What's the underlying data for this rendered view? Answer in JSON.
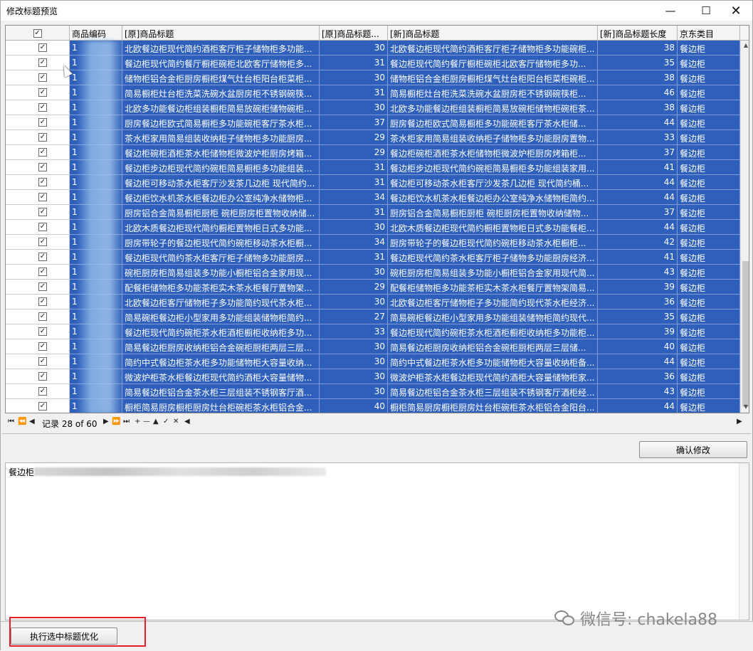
{
  "window": {
    "title": "修改标题预览",
    "min_icon": "minimize-icon",
    "max_icon": "maximize-icon",
    "close_icon": "close-icon"
  },
  "columns": [
    "",
    "商品编码",
    "[原]商品标题",
    "[原]商品标题...",
    "[新]商品标题",
    "[新]商品标题长度",
    "京东类目"
  ],
  "header_checkbox_checked": true,
  "rows": [
    {
      "code": "1",
      "orig": "北欧餐边柜现代简约酒柜客厅柜子储物柜多功能...",
      "orig_len": "30",
      "new": "北欧餐边柜现代简约酒柜客厅柜子储物柜多功能碗柜...",
      "new_len": "38",
      "cat": "餐边柜"
    },
    {
      "code": "1",
      "orig": "餐边柜现代简约餐厅橱柜碗柜北欧客厅储物柜多...",
      "orig_len": "31",
      "new": "餐边柜现代简约餐厅橱柜碗柜北欧客厅储物柜多功...",
      "new_len": "35",
      "cat": "餐边柜"
    },
    {
      "code": "1",
      "orig": "储物柜铝合金柜厨房橱柜煤气灶台柜阳台柜菜柜...",
      "orig_len": "30",
      "new": "储物柜铝合金柜厨房橱柜煤气灶台柜阳台柜菜柜碗柜...",
      "new_len": "38",
      "cat": "餐边柜"
    },
    {
      "code": "1",
      "orig": "简易橱柜灶台柜洗菜洗碗水盆厨房柜不锈钢碗筷...",
      "orig_len": "31",
      "new": "简易橱柜灶台柜洗菜洗碗水盆厨房柜不锈钢碗筷柜...",
      "new_len": "46",
      "cat": "餐边柜"
    },
    {
      "code": "1",
      "orig": "北欧多功能餐边柜组装橱柜简易放碗柜储物碗柜...",
      "orig_len": "30",
      "new": "北欧多功能餐边柜组装橱柜简易放碗柜储物柜碗柜茶...",
      "new_len": "38",
      "cat": "餐边柜"
    },
    {
      "code": "1",
      "orig": "厨房餐边柜欧式简易橱柜多功能碗柜客厅茶水柜...",
      "orig_len": "37",
      "new": "厨房餐边柜欧式简易橱柜多功能碗柜客厅茶水柜储...",
      "new_len": "44",
      "cat": "餐边柜"
    },
    {
      "code": "1",
      "orig": "茶水柜家用简易组装收纳柜子储物柜多功能厨房...",
      "orig_len": "29",
      "new": "茶水柜家用简易组装收纳柜子储物柜多功能厨房置物...",
      "new_len": "33",
      "cat": "餐边柜"
    },
    {
      "code": "1",
      "orig": "餐边柜碗柜酒柜茶水柜储物柜微波炉柜厨房烤箱...",
      "orig_len": "29",
      "new": "餐边柜碗柜酒柜茶水柜储物柜微波炉柜厨房烤箱柜...",
      "new_len": "37",
      "cat": "餐边柜"
    },
    {
      "code": "1",
      "orig": "餐边柜步边柜现代简约碗柜简易橱柜多功能组装...",
      "orig_len": "31",
      "new": "餐边柜步边柜现代简约碗柜简易橱柜多功能组装家用...",
      "new_len": "41",
      "cat": "餐边柜"
    },
    {
      "code": "1",
      "orig": "餐边柜可移动茶水柜客厅沙发茶几边柜 现代简约...",
      "orig_len": "31",
      "new": "餐边柜可移动茶水柜客厅沙发茶几边柜 现代简约桶...",
      "new_len": "44",
      "cat": "餐边柜"
    },
    {
      "code": "1",
      "orig": "餐边柜饮水机茶水柜餐边柜办公室纯净水储物柜...",
      "orig_len": "34",
      "new": "餐边柜饮水机茶水柜餐边柜办公室纯净水储物柜简约...",
      "new_len": "44",
      "cat": "餐边柜"
    },
    {
      "code": "1",
      "orig": "厨房铝合金简易橱柜厨柜 碗柜厨房柜置物收纳储...",
      "orig_len": "31",
      "new": "厨房铝合金简易橱柜厨柜 碗柜厨房柜置物收纳储物...",
      "new_len": "37",
      "cat": "餐边柜"
    },
    {
      "code": "1",
      "orig": "北欧木质餐边柜现代简约橱柜置物柜日式多功能...",
      "orig_len": "30",
      "new": "北欧木质餐边柜现代简约橱柜置物柜日式多功能餐柜...",
      "new_len": "44",
      "cat": "餐边柜"
    },
    {
      "code": "1",
      "orig": "厨房带轮子的餐边柜现代简约碗柜移动茶水柜橱...",
      "orig_len": "34",
      "new": "厨房带轮子的餐边柜现代简约碗柜移动茶水柜橱柜...",
      "new_len": "42",
      "cat": "餐边柜"
    },
    {
      "code": "1",
      "orig": "餐边柜现代简约茶水柜客厅柜子储物多功能厨房...",
      "orig_len": "31",
      "new": "餐边柜现代简约茶水柜客厅柜子储物多功能厨房经济...",
      "new_len": "41",
      "cat": "餐边柜"
    },
    {
      "code": "1",
      "orig": "碗柜厨房柜简易组装多功能小橱柜铝合金家用现...",
      "orig_len": "30",
      "new": "碗柜厨房柜简易组装多功能小橱柜铝合金家用现代简...",
      "new_len": "43",
      "cat": "餐边柜"
    },
    {
      "code": "1",
      "orig": "配餐柜储物柜多功能茶柜实木茶水柜餐厅置物架...",
      "orig_len": "29",
      "new": "配餐柜储物柜多功能茶柜实木茶水柜餐厅置物架简易...",
      "new_len": "39",
      "cat": "餐边柜"
    },
    {
      "code": "1",
      "orig": "北欧餐边柜客厅储物柜子多功能简约现代茶水柜...",
      "orig_len": "30",
      "new": "北欧餐边柜客厅储物柜子多功能简约现代茶水柜经济...",
      "new_len": "36",
      "cat": "餐边柜"
    },
    {
      "code": "1",
      "orig": "简易碗柜餐边柜小型家用多功能组装储物柜简约...",
      "orig_len": "27",
      "new": "简易碗柜餐边柜小型家用多功能组装储物柜简约现代...",
      "new_len": "35",
      "cat": "餐边柜"
    },
    {
      "code": "1",
      "orig": "餐边柜现代简约碗柜茶水柜酒柜橱柜收纳柜多功...",
      "orig_len": "33",
      "new": "餐边柜现代简约碗柜茶水柜酒柜橱柜收纳柜多功能柜...",
      "new_len": "39",
      "cat": "餐边柜"
    },
    {
      "code": "1",
      "orig": "简易餐边柜厨房收纳柜铝合金碗柜厨柜两层三层...",
      "orig_len": "30",
      "new": "简易餐边柜厨房收纳柜铝合金碗柜厨柜两层三层储...",
      "new_len": "40",
      "cat": "餐边柜"
    },
    {
      "code": "1",
      "orig": "简约中式餐边柜茶水柜多功能储物柜大容量收纳...",
      "orig_len": "30",
      "new": "简约中式餐边柜茶水柜多功能储物柜大容量收纳柜备...",
      "new_len": "44",
      "cat": "餐边柜"
    },
    {
      "code": "1",
      "orig": "微波炉柜茶水柜餐边柜现代简约酒柜大容量储物...",
      "orig_len": "30",
      "new": "微波炉柜茶水柜餐边柜现代简约酒柜大容量储物柜家...",
      "new_len": "36",
      "cat": "餐边柜"
    },
    {
      "code": "1",
      "orig": "简易餐边柜铝合金茶水柜三层组装不锈钢客厅酒...",
      "orig_len": "30",
      "new": "简易餐边柜铝合金茶水柜三层组装不锈钢客厅酒柜经...",
      "new_len": "43",
      "cat": "餐边柜"
    },
    {
      "code": "1",
      "orig": "橱柜简易厨房橱柜厨房灶台柜碗柜茶水柜铝合金...",
      "orig_len": "40",
      "new": "橱柜简易厨房橱柜厨房灶台柜碗柜茶水柜铝合金阳台...",
      "new_len": "44",
      "cat": "餐边柜"
    }
  ],
  "navigator": {
    "record_text": "记录 28 of 60"
  },
  "confirm_button": "确认修改",
  "editor_text": "餐边柜",
  "run_button": "执行选中标题优化",
  "watermark": "微信号: chakela88",
  "colors": {
    "selection": "#2e5fba",
    "highlight_box": "#e0212a"
  }
}
